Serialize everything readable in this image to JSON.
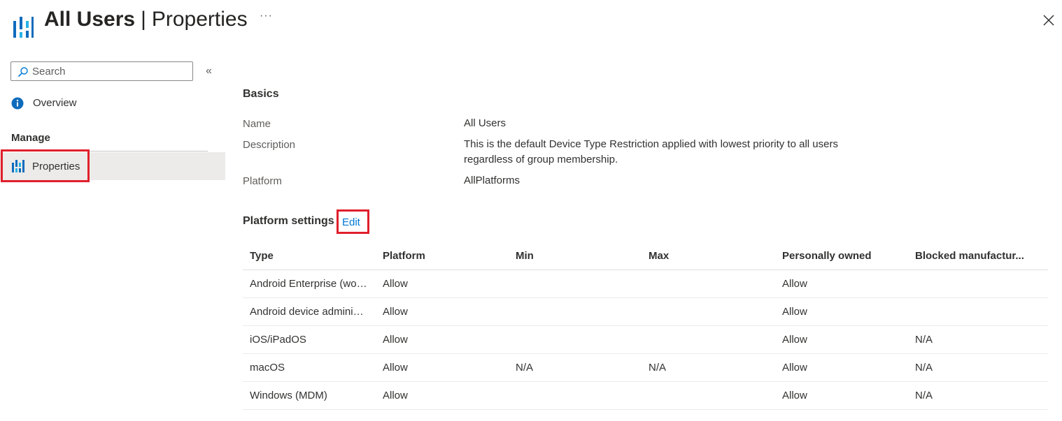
{
  "header": {
    "title_bold": "All Users",
    "title_sep": "|",
    "title_rest": "Properties",
    "more_label": "···",
    "close_icon": "close-icon",
    "app_icon": "intune-properties-icon"
  },
  "sidebar": {
    "search_placeholder": "Search",
    "collapse_label": "«",
    "overview_label": "Overview",
    "manage_label": "Manage",
    "properties_label": "Properties"
  },
  "basics": {
    "heading": "Basics",
    "name_label": "Name",
    "name_value": "All Users",
    "description_label": "Description",
    "description_value": "This is the default Device Type Restriction applied with lowest priority to all users regardless of group membership.",
    "platform_label": "Platform",
    "platform_value": "AllPlatforms"
  },
  "platform_settings": {
    "heading": "Platform settings",
    "edit_label": "Edit",
    "columns": [
      "Type",
      "Platform",
      "Min",
      "Max",
      "Personally owned",
      "Blocked manufactur..."
    ],
    "rows": [
      [
        "Android Enterprise (work profile)",
        "Allow",
        "",
        "",
        "Allow",
        ""
      ],
      [
        "Android device administrator",
        "Allow",
        "",
        "",
        "Allow",
        ""
      ],
      [
        "iOS/iPadOS",
        "Allow",
        "",
        "",
        "Allow",
        "N/A"
      ],
      [
        "macOS",
        "Allow",
        "N/A",
        "N/A",
        "Allow",
        "N/A"
      ],
      [
        "Windows (MDM)",
        "Allow",
        "",
        "",
        "Allow",
        "N/A"
      ]
    ]
  },
  "colors": {
    "accent": "#0078d4",
    "highlight_border": "#e01f2c",
    "selected_nav_bg": "#edebe9"
  }
}
